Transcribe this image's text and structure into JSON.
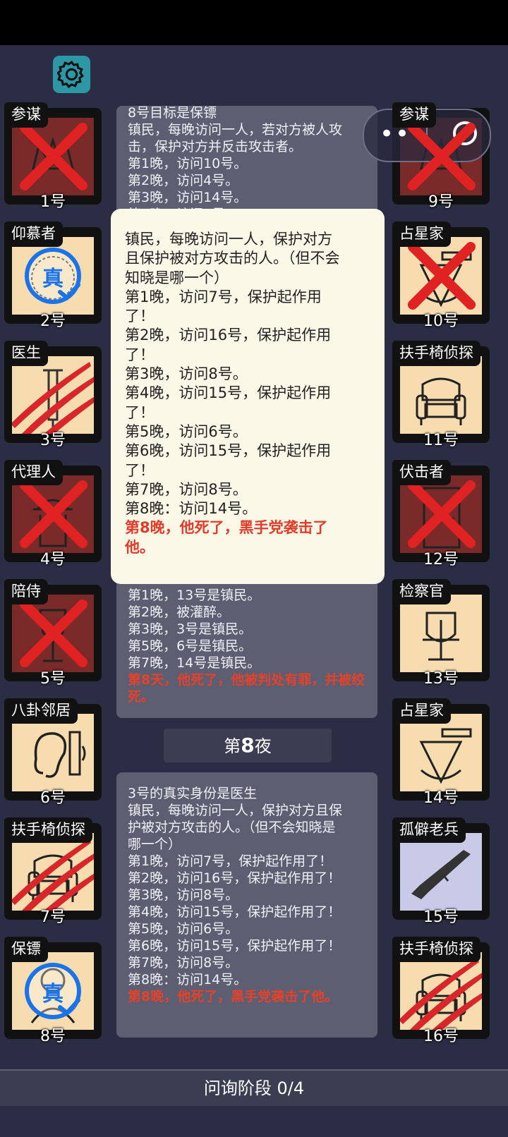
{
  "phase": {
    "label": "问询阶段 0/4"
  },
  "cards_left": [
    {
      "role": "参谋",
      "num": "1号",
      "status": "dead",
      "icon": "crown-icon"
    },
    {
      "role": "仰慕者",
      "num": "2号",
      "status": "true",
      "icon": "sunflower-icon"
    },
    {
      "role": "医生",
      "num": "3号",
      "status": "scratched",
      "icon": "syringe-icon"
    },
    {
      "role": "代理人",
      "num": "4号",
      "status": "dead",
      "icon": "agent-icon"
    },
    {
      "role": "陪侍",
      "num": "5号",
      "status": "dead",
      "icon": "wine-glass-icon"
    },
    {
      "role": "八卦邻居",
      "num": "6号",
      "status": "alive",
      "icon": "ear-icon"
    },
    {
      "role": "扶手椅侦探",
      "num": "7号",
      "status": "scratched",
      "icon": "armchair-icon"
    },
    {
      "role": "保镖",
      "num": "8号",
      "status": "true",
      "icon": "bodyguard-icon"
    }
  ],
  "cards_right": [
    {
      "role": "参谋",
      "num": "9号",
      "status": "dead",
      "icon": "crown-icon"
    },
    {
      "role": "占星家",
      "num": "10号",
      "status": "dead-light",
      "icon": "sextant-icon"
    },
    {
      "role": "扶手椅侦探",
      "num": "11号",
      "status": "alive",
      "icon": "armchair-icon"
    },
    {
      "role": "伏击者",
      "num": "12号",
      "status": "dead",
      "icon": "door-icon"
    },
    {
      "role": "检察官",
      "num": "13号",
      "status": "alive",
      "icon": "scales-icon"
    },
    {
      "role": "占星家",
      "num": "14号",
      "status": "alive",
      "icon": "sextant-icon"
    },
    {
      "role": "孤僻老兵",
      "num": "15号",
      "status": "vet",
      "icon": "rifle-icon"
    },
    {
      "role": "扶手椅侦探",
      "num": "16号",
      "status": "scratched",
      "icon": "armchair-icon"
    }
  ],
  "stamp_text": "真",
  "log_top": [
    "8号目标是保镖",
    "镇民，每晚访问一人，若对方被人攻",
    "击，保护对方并反击攻击者。",
    "第1晚，访问10号。",
    "第2晚，访问4号。",
    "第3晚，访问14号。",
    "第4晚，访问8号。"
  ],
  "log_mid": [
    "第1晚，13号是镇民。",
    "第2晚，被灌醉。",
    "第3晚，3号是镇民。",
    "第5晚，6号是镇民。",
    "第7晚，14号是镇民。"
  ],
  "log_mid_red": "第8天，他死了，他被判处有罪，并被绞死。",
  "night_prefix": "第",
  "night_num": "8",
  "night_suffix": "夜",
  "log_bottom": [
    "3号的真实身份是医生",
    "镇民，每晚访问一人，保护对方且保",
    "护被对方攻击的人。（但不会知晓是",
    "哪一个）",
    "第1晚，访问7号，保护起作用了！",
    "第2晚，访问16号，保护起作用了！",
    "第3晚，访问8号。",
    "第4晚，访问15号，保护起作用了！",
    "第5晚，访问6号。",
    "第6晚，访问15号，保护起作用了！",
    "第7晚，访问8号。",
    "第8晚：访问14号。"
  ],
  "log_bottom_red": "第8晚，他死了，黑手党袭击了他。",
  "popup": {
    "lines": [
      "镇民，每晚访问一人，保护对方",
      "且保护被对方攻击的人。（但不会",
      "知晓是哪一个）",
      "第1晚，访问7号，保护起作用",
      "了！",
      "第2晚，访问16号，保护起作用",
      "了！",
      "第3晚，访问8号。",
      "第4晚，访问15号，保护起作用",
      "了！",
      "第5晚，访问6号。",
      "第6晚，访问15号，保护起作用",
      "了！",
      "第7晚，访问8号。",
      "第8晚：访问14号。"
    ],
    "red_lines": [
      "第8晚，他死了，黑手党袭击了",
      "他。"
    ]
  },
  "capsule": {
    "more": "•••"
  }
}
